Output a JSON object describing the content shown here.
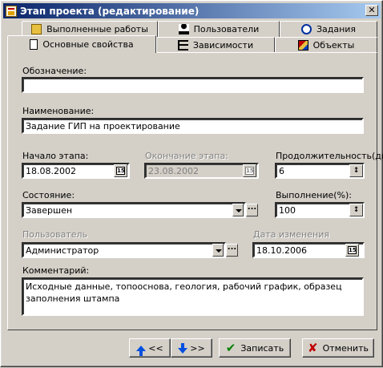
{
  "window": {
    "title": "Этап проекта (редактирование)",
    "close_label": "✕"
  },
  "tabs": {
    "row1": [
      {
        "label": "Выполненные работы",
        "icon": "folder-work-icon"
      },
      {
        "label": "Пользователи",
        "icon": "users-icon"
      },
      {
        "label": "Задания",
        "icon": "clock-task-icon"
      }
    ],
    "row2": [
      {
        "label": "Основные свойства",
        "icon": "document-icon",
        "active": true
      },
      {
        "label": "Зависимости",
        "icon": "dependencies-icon"
      },
      {
        "label": "Объекты",
        "icon": "objects-icon"
      }
    ]
  },
  "form": {
    "designation_label": "Обозначение:",
    "designation_value": "",
    "name_label": "Наименование:",
    "name_value": "Задание ГИП на проектирование",
    "start_label": "Начало этапа:",
    "start_value": "18.08.2002",
    "end_label": "Окончание этапа:",
    "end_value": "23.08.2002",
    "duration_label": "Продолжительность(дн",
    "duration_value": "6",
    "state_label": "Состояние:",
    "state_value": "Завершен",
    "completion_label": "Выполнение(%):",
    "completion_value": "100",
    "user_label": "Пользователь",
    "user_value": "Администратор",
    "changed_label": "Дата изменения",
    "changed_value": "18.10.2006",
    "comment_label": "Комментарий:",
    "comment_value": "Исходные данные, топооснова, геология, рабочий график, образец заполнения штампа",
    "cal_glyph": "15",
    "dots_glyph": "..."
  },
  "buttons": {
    "prev_label": "<<",
    "next_label": ">>",
    "save_label": "Записать",
    "cancel_label": "Отменить"
  },
  "colors": {
    "titlebar_start": "#0a246a",
    "titlebar_end": "#a6caf0",
    "save_icon": "#008000",
    "cancel_icon": "#c00000",
    "nav_arrow": "#0050e0"
  }
}
